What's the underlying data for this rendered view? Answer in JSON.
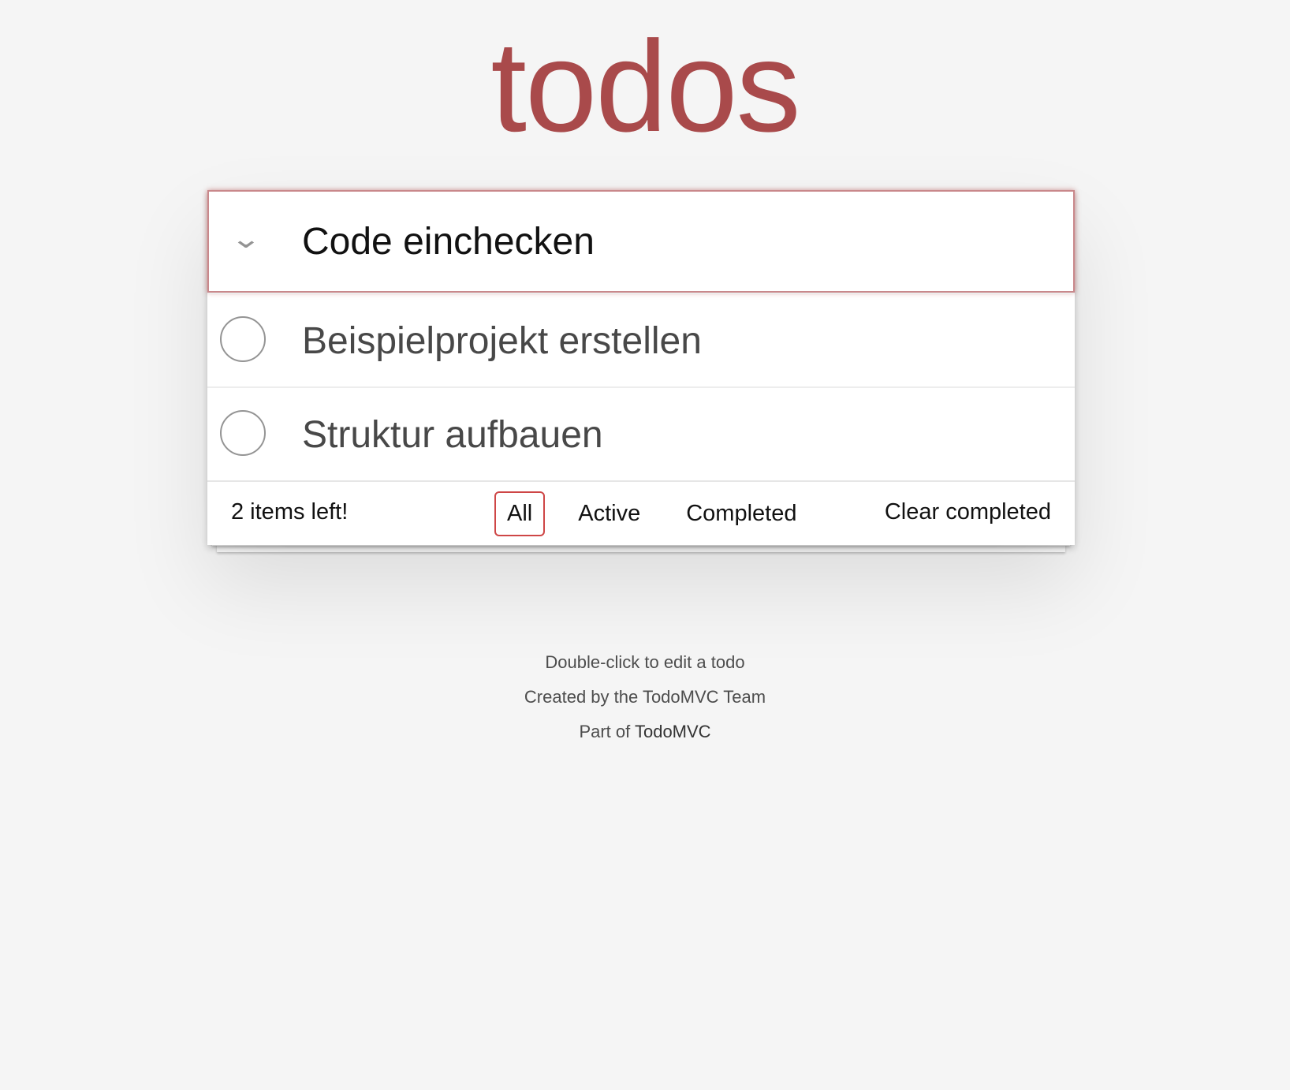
{
  "header": {
    "title": "todos"
  },
  "new_todo": {
    "value": "Code einchecken"
  },
  "todos": [
    {
      "label": "Beispielprojekt erstellen",
      "completed": false
    },
    {
      "label": "Struktur aufbauen",
      "completed": false
    }
  ],
  "footer": {
    "count": "2 items left!",
    "filters": [
      "All",
      "Active",
      "Completed"
    ],
    "selected_filter": "All",
    "clear": "Clear completed"
  },
  "info": {
    "edit_hint": "Double-click to edit a todo",
    "created_by": "Created by the TodoMVC Team",
    "part_of_prefix": "Part of",
    "part_of_link": "TodoMVC"
  },
  "colors": {
    "accent": "#a94a4b",
    "background": "#f5f5f5"
  }
}
